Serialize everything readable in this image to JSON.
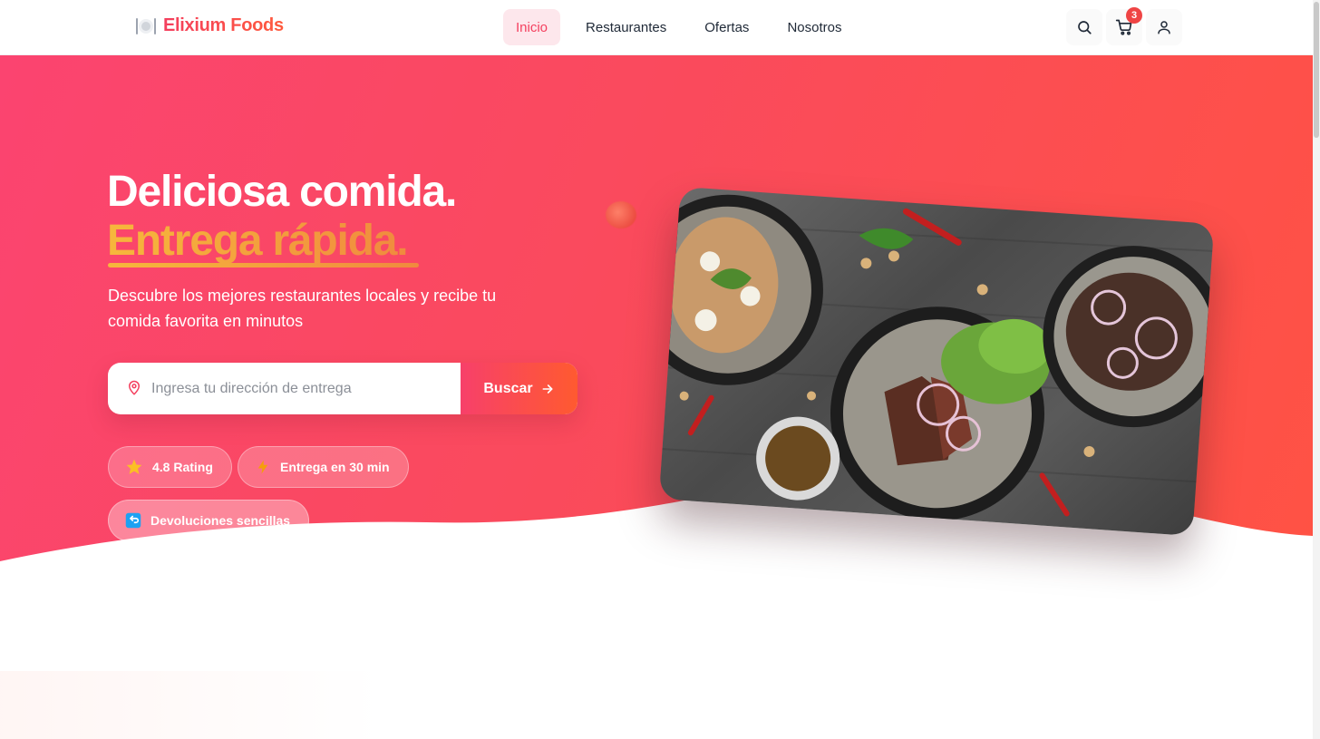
{
  "brand": {
    "name": "Elixium Foods",
    "icon": "plate-utensils-icon",
    "accent": "#f43f5e",
    "accent2": "#ff5a3c"
  },
  "nav": {
    "items": [
      {
        "label": "Inicio",
        "active": true
      },
      {
        "label": "Restaurantes",
        "active": false
      },
      {
        "label": "Ofertas",
        "active": false
      },
      {
        "label": "Nosotros",
        "active": false
      }
    ]
  },
  "header_actions": {
    "search_icon": "search-icon",
    "cart_icon": "cart-icon",
    "cart_count": "3",
    "user_icon": "user-icon"
  },
  "hero": {
    "title_line1": "Deliciosa comida.",
    "title_line2": "Entrega rápida.",
    "subtitle": "Descubre los mejores restaurantes locales y recibe tu comida favorita en minutos",
    "search": {
      "placeholder": "Ingresa tu dirección de entrega",
      "value": "",
      "button_label": "Buscar"
    },
    "badges": [
      {
        "icon": "star-icon",
        "label": "4.8 Rating"
      },
      {
        "icon": "lightning-icon",
        "label": "Entrega en 30 min"
      },
      {
        "icon": "return-arrow-icon",
        "label": "Devoluciones sencillas"
      }
    ],
    "image": "food-dishes-photo"
  }
}
